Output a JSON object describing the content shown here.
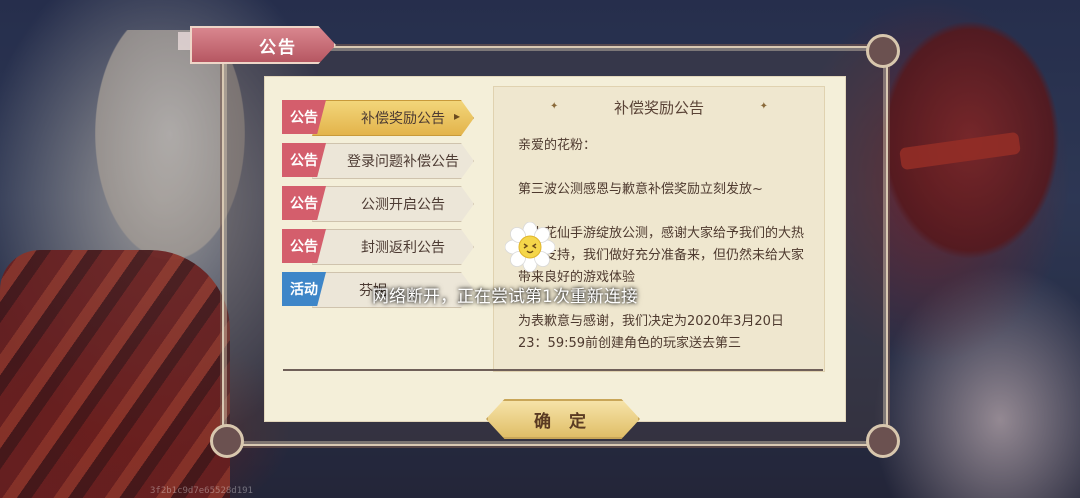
{
  "header": {
    "title": "公告"
  },
  "tabs": [
    {
      "badge": "公告",
      "label": "补偿奖励公告",
      "active": true,
      "type": "notice"
    },
    {
      "badge": "公告",
      "label": "登录问题补偿公告",
      "active": false,
      "type": "notice"
    },
    {
      "badge": "公告",
      "label": "公测开启公告",
      "active": false,
      "type": "notice"
    },
    {
      "badge": "公告",
      "label": "封测返利公告",
      "active": false,
      "type": "notice"
    },
    {
      "badge": "活动",
      "label": "芬妮",
      "active": false,
      "type": "event"
    }
  ],
  "content": {
    "title": "补偿奖励公告",
    "greeting": "亲爱的花粉：",
    "line1": "第三波公测感恩与歉意补偿奖励立刻发放~",
    "para2": "《小花仙手游绽放公测，感谢大家给予我们的大热情和支持，我们做好充分准备来，但仍然未给大家带来良好的游戏体验",
    "para3": "为表歉意与感谢，我们决定为2020年3月20日23：59:59前创建角色的玩家送去第三"
  },
  "confirm_label": "确 定",
  "toast": "网络断开，正在尝试第1次重新连接",
  "footer_id": "3f2b1c9d7e65528d191"
}
